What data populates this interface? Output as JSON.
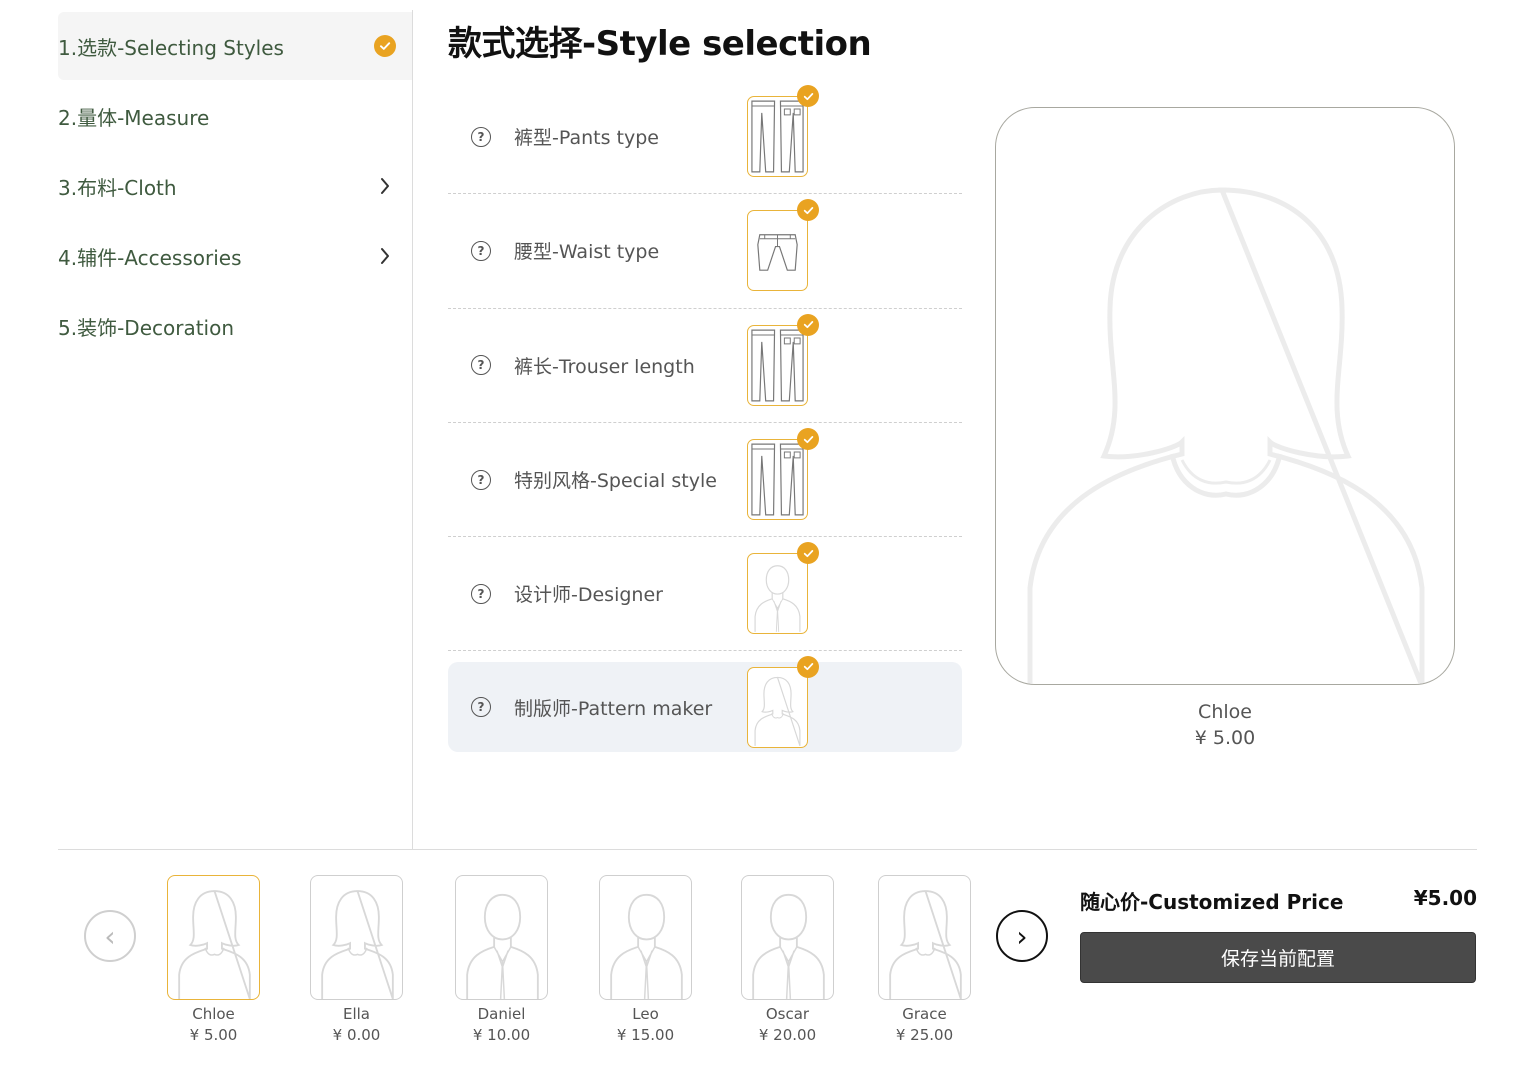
{
  "sidebar": {
    "items": [
      {
        "label": "1.选款-Selecting Styles"
      },
      {
        "label": "2.量体-Measure"
      },
      {
        "label": "3.布料-Cloth"
      },
      {
        "label": "4.辅件-Accessories"
      },
      {
        "label": "5.装饰-Decoration"
      }
    ]
  },
  "main": {
    "title": "款式选择-Style selection",
    "options": [
      {
        "label": "裤型-Pants type",
        "icon": "pants-icon"
      },
      {
        "label": "腰型-Waist type",
        "icon": "waist-icon"
      },
      {
        "label": "裤长-Trouser length",
        "icon": "pants-icon"
      },
      {
        "label": "特别风格-Special style",
        "icon": "pants-icon"
      },
      {
        "label": "设计师-Designer",
        "icon": "male-avatar-icon"
      },
      {
        "label": "制版师-Pattern maker",
        "icon": "female-avatar-icon"
      }
    ],
    "help_glyph": "?"
  },
  "preview": {
    "name": "Chloe",
    "price": "¥ 5.00"
  },
  "carousel": {
    "prev_glyph": "‹",
    "next_glyph": "›",
    "cards": [
      {
        "name": "Chloe",
        "price": "¥ 5.00",
        "avatar": "female-avatar-icon"
      },
      {
        "name": "Ella",
        "price": "¥ 0.00",
        "avatar": "female-avatar-icon"
      },
      {
        "name": "Daniel",
        "price": "¥ 10.00",
        "avatar": "male-avatar-icon"
      },
      {
        "name": "Leo",
        "price": "¥ 15.00",
        "avatar": "male-avatar-icon"
      },
      {
        "name": "Oscar",
        "price": "¥ 20.00",
        "avatar": "male-avatar-icon"
      },
      {
        "name": "Grace",
        "price": "¥ 25.00",
        "avatar": "female-avatar-icon"
      }
    ]
  },
  "pricing": {
    "label": "随心价-Customized Price",
    "value": "¥5.00",
    "save_label": "保存当前配置"
  },
  "colors": {
    "accent": "#e9a321",
    "button": "#4a4a4a"
  }
}
